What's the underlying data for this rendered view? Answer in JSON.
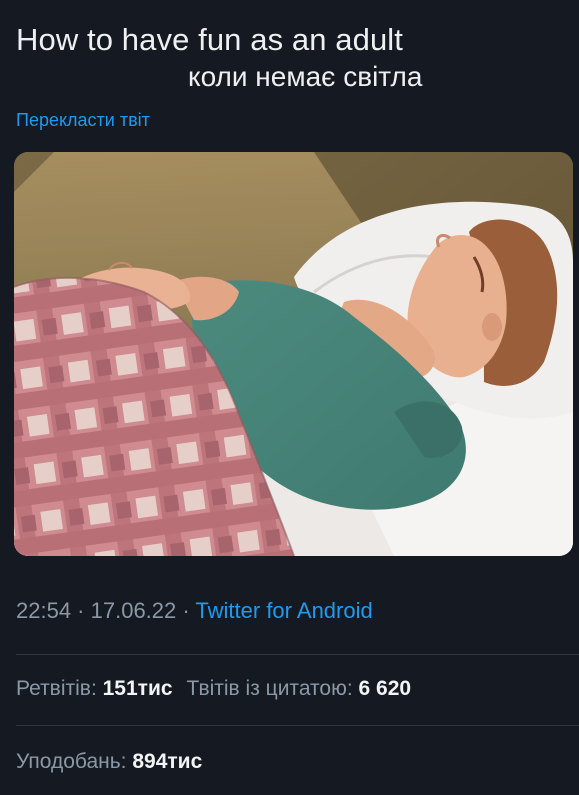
{
  "tweet": {
    "text_line1": "How to have fun as an adult",
    "text_line2": "коли немає світла",
    "translate_label": "Перекласти твіт"
  },
  "meta": {
    "time": "22:54",
    "separator": " · ",
    "date": "17.06.22",
    "source": "Twitter for Android"
  },
  "stats": {
    "retweets_label": "Ретвітів: ",
    "retweets_value": "151тис",
    "quotes_label": "Твітів із цитатою: ",
    "quotes_value": "6 620",
    "likes_label": "Уподобань: ",
    "likes_value": "894тис"
  },
  "colors": {
    "background": "#151a22",
    "link": "#1d9bf0",
    "muted": "#8b98a5"
  }
}
